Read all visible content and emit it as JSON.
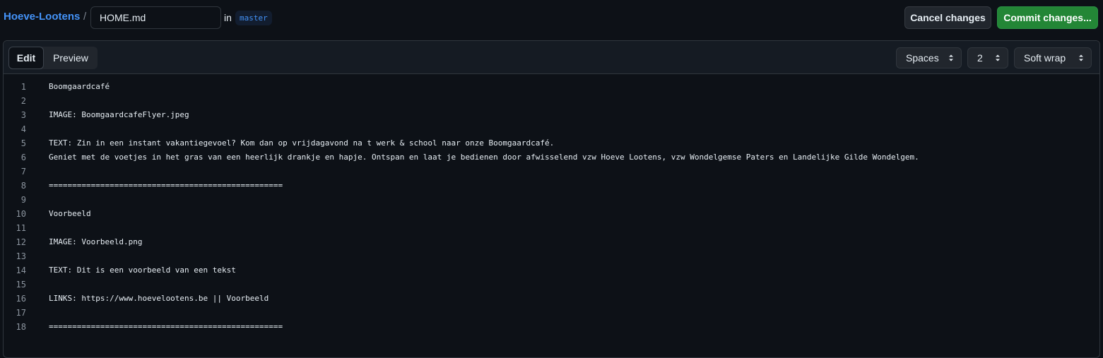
{
  "header": {
    "repo": "Hoeve-Lootens",
    "separator": "/",
    "filename": "HOME.md",
    "in_label": "in",
    "branch": "master",
    "cancel_label": "Cancel changes",
    "commit_label": "Commit changes..."
  },
  "editor": {
    "tabs": {
      "edit": "Edit",
      "preview": "Preview"
    },
    "indent_mode": "Spaces",
    "indent_size": "2",
    "wrap_mode": "Soft wrap",
    "lines": [
      {
        "n": "1",
        "t": "Boomgaardcafé"
      },
      {
        "n": "2",
        "t": ""
      },
      {
        "n": "3",
        "t": "IMAGE: BoomgaardcafeFlyer.jpeg"
      },
      {
        "n": "4",
        "t": ""
      },
      {
        "n": "5",
        "t": "TEXT: Zin in een instant vakantiegevoel? Kom dan op vrijdagavond na t werk & school naar onze Boomgaardcafé."
      },
      {
        "n": "6",
        "t": "Geniet met de voetjes in het gras van een heerlijk drankje en hapje. Ontspan en laat je bedienen door afwisselend vzw Hoeve Lootens, vzw Wondelgemse Paters en Landelijke Gilde Wondelgem."
      },
      {
        "n": "7",
        "t": ""
      },
      {
        "n": "8",
        "t": "=================================================="
      },
      {
        "n": "9",
        "t": ""
      },
      {
        "n": "10",
        "t": "Voorbeeld"
      },
      {
        "n": "11",
        "t": ""
      },
      {
        "n": "12",
        "t": "IMAGE: Voorbeeld.png"
      },
      {
        "n": "13",
        "t": ""
      },
      {
        "n": "14",
        "t": "TEXT: Dit is een voorbeeld van een tekst"
      },
      {
        "n": "15",
        "t": ""
      },
      {
        "n": "16",
        "t": "LINKS: https://www.hoevelootens.be || Voorbeeld"
      },
      {
        "n": "17",
        "t": ""
      },
      {
        "n": "18",
        "t": "=================================================="
      }
    ]
  }
}
